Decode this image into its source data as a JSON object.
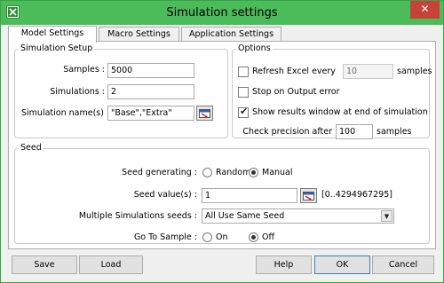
{
  "window": {
    "title": "Simulation settings",
    "close_glyph": "✕"
  },
  "tabs": [
    {
      "label": "Model Settings",
      "active": true
    },
    {
      "label": "Macro Settings",
      "active": false
    },
    {
      "label": "Application Settings",
      "active": false
    }
  ],
  "simulation_setup": {
    "legend": "Simulation Setup",
    "samples_label": "Samples :",
    "samples_value": "5000",
    "simulations_label": "Simulations :",
    "simulations_value": "2",
    "names_label": "Simulation name(s) :",
    "names_value": "\"Base\",\"Extra\""
  },
  "options": {
    "legend": "Options",
    "refresh_label": "Refresh Excel every",
    "refresh_value": "10",
    "refresh_unit": "samples",
    "refresh_checked": false,
    "stop_label": "Stop on Output error",
    "stop_checked": false,
    "show_results_label": "Show results window at end of simulation",
    "show_results_checked": true,
    "precision_label": "Check precision after",
    "precision_value": "100",
    "precision_unit": "samples"
  },
  "seed": {
    "legend": "Seed",
    "generating_label": "Seed generating :",
    "random_label": "Random",
    "manual_label": "Manual",
    "generating_selected": "Manual",
    "values_label": "Seed value(s) :",
    "values_value": "1",
    "values_range": "[0..4294967295]",
    "multiple_label": "Multiple Simulations seeds :",
    "multiple_value": "All Use Same Seed",
    "goto_label": "Go To Sample :",
    "on_label": "On",
    "off_label": "Off",
    "goto_selected": "Off"
  },
  "footer": {
    "save": "Save",
    "load": "Load",
    "help": "Help",
    "ok": "OK",
    "cancel": "Cancel"
  },
  "colors": {
    "title_bar": "#4cbb5a",
    "close_button": "#c7433a",
    "dialog_background": "#f0f0f0"
  },
  "icons": {
    "app": "spreadsheet-icon",
    "picker": "cell-range-picker-icon",
    "dropdown": "chevron-down-icon"
  }
}
